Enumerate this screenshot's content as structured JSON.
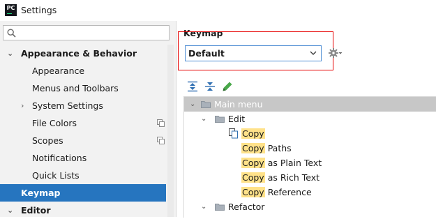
{
  "window": {
    "app_icon": "PC",
    "title": "Settings"
  },
  "sidebar": {
    "search": {
      "icon": "search-icon",
      "value": "",
      "placeholder": ""
    },
    "items": [
      {
        "label": "Appearance & Behavior",
        "expanded": true
      },
      {
        "label": "Appearance"
      },
      {
        "label": "Menus and Toolbars"
      },
      {
        "label": "System Settings",
        "collapsed": true
      },
      {
        "label": "File Colors",
        "badge": "copy-icon"
      },
      {
        "label": "Scopes",
        "badge": "copy-icon"
      },
      {
        "label": "Notifications"
      },
      {
        "label": "Quick Lists"
      },
      {
        "label": "Keymap",
        "selected": true
      },
      {
        "label": "Editor",
        "expanded": true
      }
    ]
  },
  "main": {
    "heading": "Keymap",
    "keymap_select": {
      "value": "Default"
    },
    "toolbar": [
      "expand-all-icon",
      "collapse-all-icon",
      "edit-icon",
      "gear-icon"
    ],
    "tree": [
      {
        "label": "Main menu",
        "selected": true
      },
      {
        "label": "Edit"
      },
      {
        "highlight": "Copy",
        "rest": ""
      },
      {
        "highlight": "Copy",
        "rest": " Paths"
      },
      {
        "highlight": "Copy",
        "rest": " as Plain Text"
      },
      {
        "highlight": "Copy",
        "rest": " as Rich Text"
      },
      {
        "highlight": "Copy",
        "rest": " Reference"
      },
      {
        "label": "Refactor"
      }
    ]
  },
  "colors": {
    "selection": "#2675bf",
    "highlight": "#ffe28a",
    "annotation_box": "#e60000"
  }
}
